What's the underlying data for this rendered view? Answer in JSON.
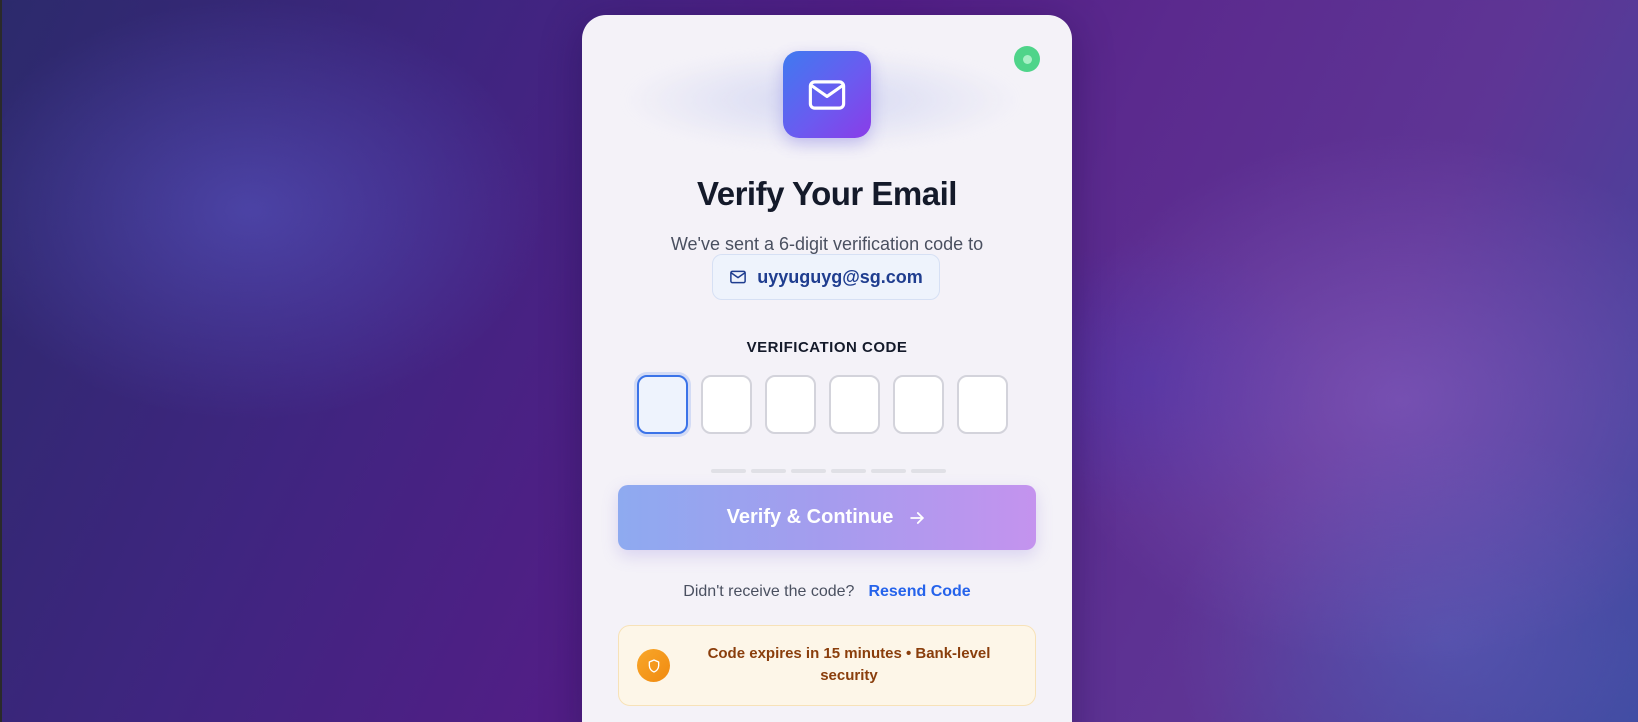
{
  "title": "Verify Your Email",
  "subtitle": "We've sent a 6-digit verification code to",
  "email": "uyyuguyg@sg.com",
  "code_label": "VERIFICATION CODE",
  "otp": {
    "digits": [
      "",
      "",
      "",
      "",
      "",
      ""
    ],
    "active_index": 0,
    "filled_count": 0
  },
  "verify_button": {
    "label": "Verify & Continue",
    "enabled": false
  },
  "resend": {
    "prompt": "Didn't receive the code?",
    "link_label": "Resend Code"
  },
  "security_note": {
    "text": "Code expires in 15 minutes • Bank-level security"
  },
  "colors": {
    "accent": "#3b73e8",
    "link": "#2563eb",
    "status_online": "#4fd48a",
    "warning_text": "#8a3e0c"
  },
  "icons": {
    "logo": "mail-icon",
    "email_chip": "mail-icon",
    "button": "arrow-right-icon",
    "security": "shield-icon",
    "status": "status-dot-icon"
  }
}
